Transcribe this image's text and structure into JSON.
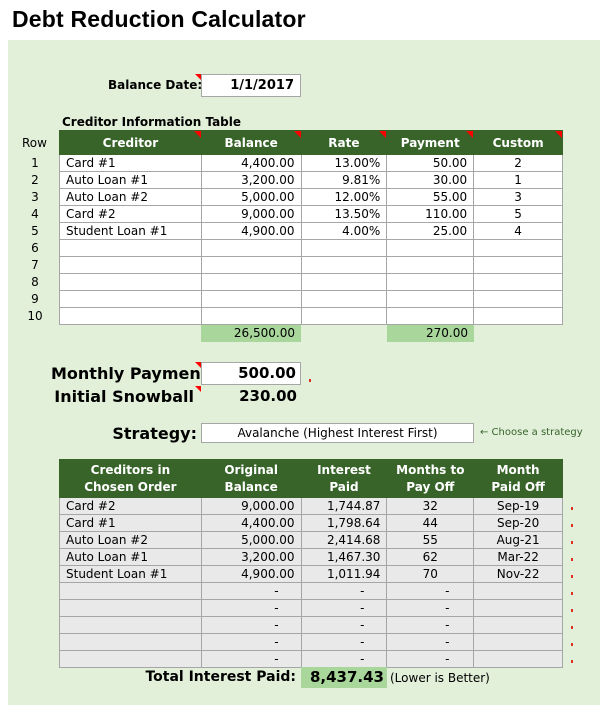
{
  "title": "Debt Reduction Calculator",
  "balance_date": {
    "label": "Balance Date:",
    "value": "1/1/2017"
  },
  "creditor_table": {
    "caption": "Creditor Information Table",
    "row_header": "Row",
    "columns": [
      "Creditor",
      "Balance",
      "Rate",
      "Payment",
      "Custom"
    ],
    "rows": [
      {
        "row": "1",
        "creditor": "Card #1",
        "balance": "4,400.00",
        "rate": "13.00%",
        "payment": "50.00",
        "custom": "2"
      },
      {
        "row": "2",
        "creditor": "Auto Loan #1",
        "balance": "3,200.00",
        "rate": "9.81%",
        "payment": "30.00",
        "custom": "1"
      },
      {
        "row": "3",
        "creditor": "Auto Loan #2",
        "balance": "5,000.00",
        "rate": "12.00%",
        "payment": "55.00",
        "custom": "3"
      },
      {
        "row": "4",
        "creditor": "Card #2",
        "balance": "9,000.00",
        "rate": "13.50%",
        "payment": "110.00",
        "custom": "5"
      },
      {
        "row": "5",
        "creditor": "Student Loan #1",
        "balance": "4,900.00",
        "rate": "4.00%",
        "payment": "25.00",
        "custom": "4"
      },
      {
        "row": "6",
        "creditor": "",
        "balance": "",
        "rate": "",
        "payment": "",
        "custom": ""
      },
      {
        "row": "7",
        "creditor": "",
        "balance": "",
        "rate": "",
        "payment": "",
        "custom": ""
      },
      {
        "row": "8",
        "creditor": "",
        "balance": "",
        "rate": "",
        "payment": "",
        "custom": ""
      },
      {
        "row": "9",
        "creditor": "",
        "balance": "",
        "rate": "",
        "payment": "",
        "custom": ""
      },
      {
        "row": "10",
        "creditor": "",
        "balance": "",
        "rate": "",
        "payment": "",
        "custom": ""
      }
    ],
    "total_balance": "26,500.00",
    "total_payment": "270.00"
  },
  "monthly_payment": {
    "label": "Monthly Payment",
    "value": "500.00"
  },
  "initial_snowball": {
    "label": "Initial Snowball",
    "value": "230.00"
  },
  "strategy": {
    "label": "Strategy:",
    "value": "Avalanche (Highest Interest First)",
    "hint": "← Choose a strategy"
  },
  "results_table": {
    "columns": [
      "Creditors in Chosen Order",
      "Original Balance",
      "Interest Paid",
      "Months to Pay Off",
      "Month Paid Off"
    ],
    "rows": [
      {
        "creditor": "Card #2",
        "original_balance": "9,000.00",
        "interest_paid": "1,744.87",
        "months": "32",
        "month_paid_off": "Sep-19"
      },
      {
        "creditor": "Card #1",
        "original_balance": "4,400.00",
        "interest_paid": "1,798.64",
        "months": "44",
        "month_paid_off": "Sep-20"
      },
      {
        "creditor": "Auto Loan #2",
        "original_balance": "5,000.00",
        "interest_paid": "2,414.68",
        "months": "55",
        "month_paid_off": "Aug-21"
      },
      {
        "creditor": "Auto Loan #1",
        "original_balance": "3,200.00",
        "interest_paid": "1,467.30",
        "months": "62",
        "month_paid_off": "Mar-22"
      },
      {
        "creditor": "Student Loan #1",
        "original_balance": "4,900.00",
        "interest_paid": "1,011.94",
        "months": "70",
        "month_paid_off": "Nov-22"
      },
      {
        "creditor": "",
        "original_balance": "-",
        "interest_paid": "-",
        "months": "-",
        "month_paid_off": ""
      },
      {
        "creditor": "",
        "original_balance": "-",
        "interest_paid": "-",
        "months": "-",
        "month_paid_off": ""
      },
      {
        "creditor": "",
        "original_balance": "-",
        "interest_paid": "-",
        "months": "-",
        "month_paid_off": ""
      },
      {
        "creditor": "",
        "original_balance": "-",
        "interest_paid": "-",
        "months": "-",
        "month_paid_off": ""
      },
      {
        "creditor": "",
        "original_balance": "-",
        "interest_paid": "-",
        "months": "-",
        "month_paid_off": ""
      }
    ]
  },
  "total_interest": {
    "label": "Total Interest Paid:",
    "value": "8,437.43",
    "note": "(Lower is Better)"
  },
  "colors": {
    "panel_bg": "#e2f0da",
    "header_green": "#38642a",
    "total_green": "#a9d69a",
    "comment_red": "#ff0000"
  }
}
